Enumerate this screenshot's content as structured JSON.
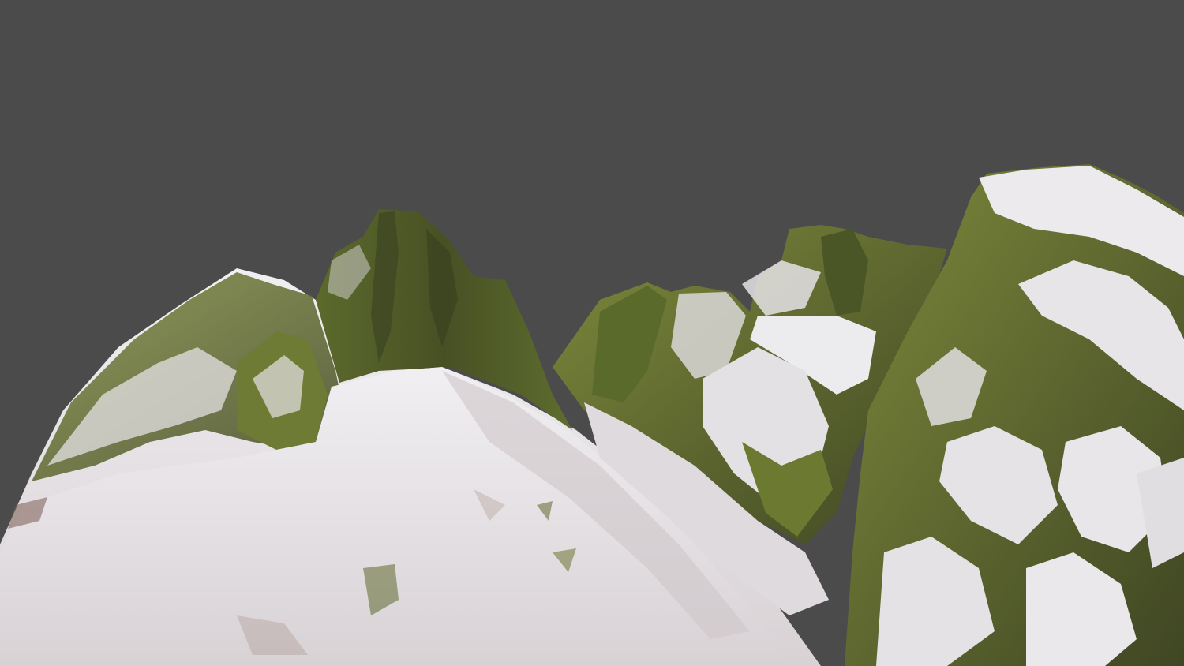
{
  "scene": {
    "description_visible_text": "",
    "background_color": "#4b4b4b",
    "palette": {
      "snow": "#e9e7ea",
      "snow_shadow": "#c9c3c6",
      "rock_dark": "#3d4225",
      "moss": "#6f7d33",
      "moss_light": "#8f9a45",
      "dirt": "#7a5b52"
    }
  }
}
